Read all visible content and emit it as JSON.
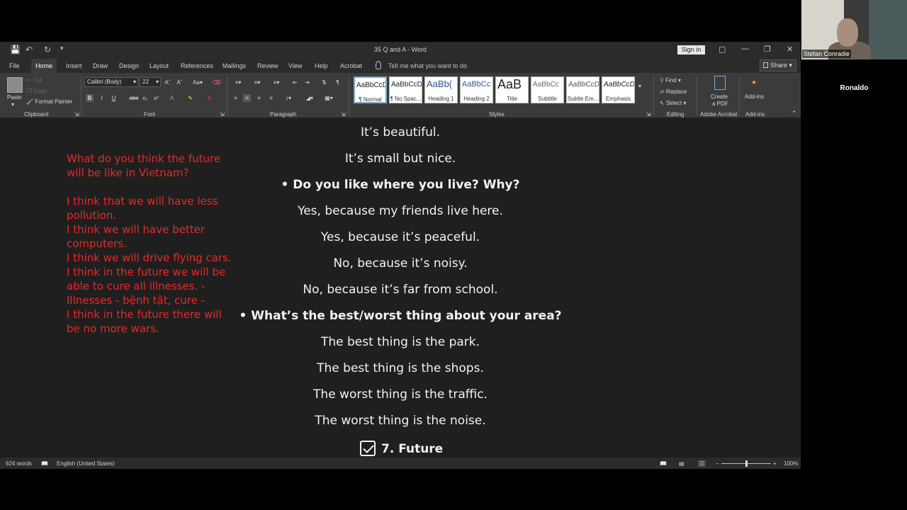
{
  "window": {
    "title": "35 Q and A  -  Word",
    "sign_in": "Sign in",
    "share": "Share",
    "tell_me": "Tell me what you want to do"
  },
  "tabs": [
    "File",
    "Home",
    "Insert",
    "Draw",
    "Design",
    "Layout",
    "References",
    "Mailings",
    "Review",
    "View",
    "Help",
    "Acrobat"
  ],
  "ribbon": {
    "clipboard": {
      "paste": "Paste",
      "cut": "Cut",
      "copy": "Copy",
      "format_painter": "Format Painter",
      "label": "Clipboard"
    },
    "font": {
      "name": "Calibri (Body)",
      "size": "22",
      "label": "Font"
    },
    "paragraph": {
      "label": "Paragraph"
    },
    "styles": {
      "label": "Styles",
      "items": [
        {
          "sample": "AaBbCcD",
          "name": "¶ Normal"
        },
        {
          "sample": "AaBbCcD",
          "name": "¶ No Spac..."
        },
        {
          "sample": "AaBb(",
          "name": "Heading 1"
        },
        {
          "sample": "AaBbCc",
          "name": "Heading 2"
        },
        {
          "sample": "AaB",
          "name": "Title"
        },
        {
          "sample": "AaBbCc",
          "name": "Subtitle"
        },
        {
          "sample": "AaBbCcD",
          "name": "Subtle Em..."
        },
        {
          "sample": "AaBbCcD",
          "name": "Emphasis"
        }
      ]
    },
    "editing": {
      "find": "Find",
      "replace": "Replace",
      "select": "Select",
      "label": "Editing"
    },
    "acrobat": {
      "create_pdf_1": "Create",
      "create_pdf_2": "a PDF",
      "label": "Adobe Acrobat"
    },
    "addins": {
      "button": "Add-ins",
      "label": "Add-ins"
    }
  },
  "document": {
    "lines": [
      {
        "text": "It’s beautiful.",
        "bold": false
      },
      {
        "text": "It’s small but nice.",
        "bold": false
      },
      {
        "text": "• Do you like where you live? Why?",
        "bold": true
      },
      {
        "text": "Yes, because my friends live here.",
        "bold": false
      },
      {
        "text": "Yes, because it’s peaceful.",
        "bold": false
      },
      {
        "text": "No, because it’s noisy.",
        "bold": false
      },
      {
        "text": "No, because it’s far from school.",
        "bold": false
      },
      {
        "text": "• What’s the best/worst thing about your area?",
        "bold": true
      },
      {
        "text": "The best thing is the park.",
        "bold": false
      },
      {
        "text": "The best thing is the shops.",
        "bold": false
      },
      {
        "text": "The worst thing is the traffic.",
        "bold": false
      },
      {
        "text": "The worst thing is the noise.",
        "bold": false
      }
    ],
    "section_heading": "7. Future",
    "notes": [
      "What do you think the future",
      "will be like in Vietnam?",
      "",
      "I think that we will have less",
      "pollution.",
      "I think we will have better",
      "computers.",
      "I think we will drive flying cars.",
      "I think in the future we will be",
      "able to cure all illnesses. -",
      "Illnesses - bệnh tật, cure -",
      "I think in the future there will",
      "be no more wars."
    ],
    "notes_color": "#e32a2a"
  },
  "status": {
    "words": "624 words",
    "language": "English (United States)",
    "zoom": "100%"
  },
  "meeting": {
    "presenter": "Stefan Conradie",
    "participant": "Ronaldo"
  }
}
